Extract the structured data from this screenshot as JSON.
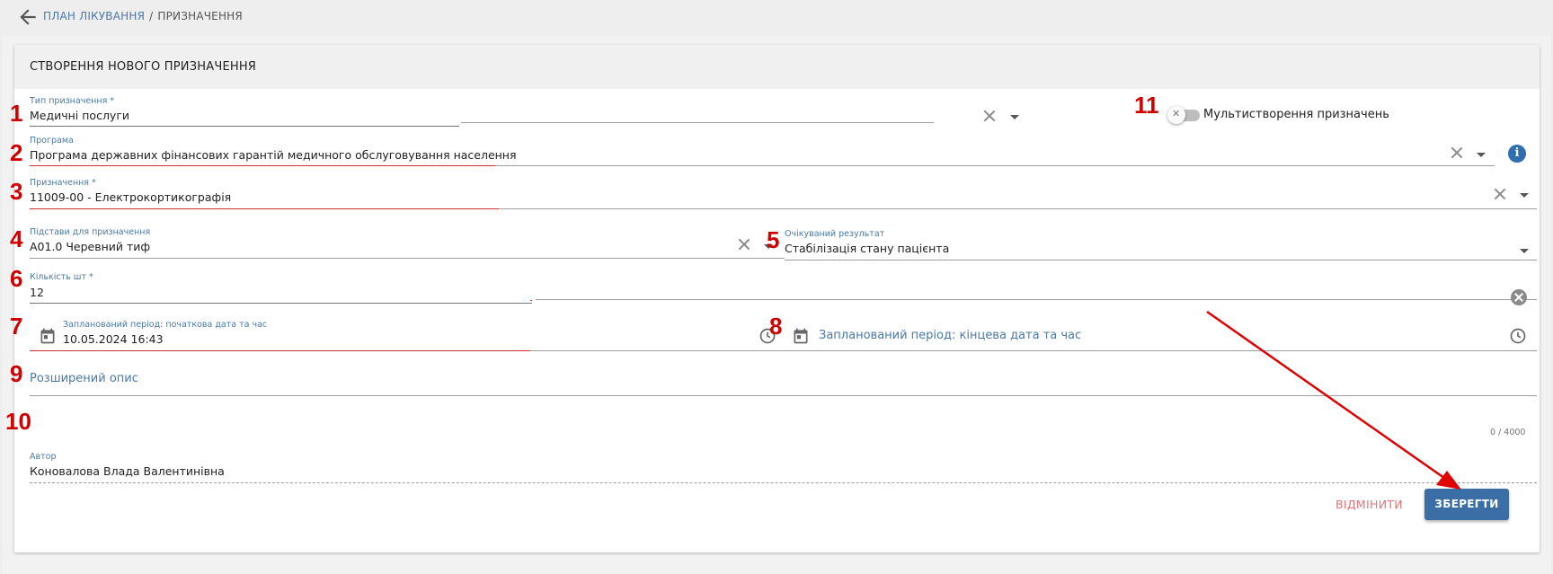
{
  "breadcrumb": {
    "back_icon": "arrow-left-icon",
    "parent": "ПЛАН ЛІКУВАННЯ",
    "separator": "/",
    "current": "ПРИЗНАЧЕННЯ"
  },
  "card": {
    "title": "СТВОРЕННЯ НОВОГО ПРИЗНАЧЕННЯ"
  },
  "form": {
    "type": {
      "label": "Тип призначення *",
      "value": "Медичні послуги"
    },
    "multi_create": {
      "label": "Мультистворення призначень",
      "checked": false
    },
    "program": {
      "label": "Програма",
      "value": "Програма державних фінансових гарантій медичного обслуговування населення"
    },
    "assignment": {
      "label": "Призначення *",
      "value": "11009-00 - Електрокортикографія"
    },
    "grounds": {
      "label": "Підстави для призначення",
      "value": "A01.0 Черевний тиф"
    },
    "expected_result": {
      "label": "Очікуваний результат",
      "value": "Стабілізація стану пацієнта"
    },
    "quantity": {
      "label": "Кількість шт *",
      "value": "12"
    },
    "start_period": {
      "label": "Запланований період: початкова дата та час",
      "value": "10.05.2024 16:43"
    },
    "end_period": {
      "placeholder": "Запланований період: кінцева дата та час"
    },
    "description": {
      "placeholder": "Розширений опис",
      "counter": "0 / 4000"
    },
    "author": {
      "label": "Автор",
      "value": "Коновалова Влада Валентинівна"
    }
  },
  "actions": {
    "cancel": "ВІДМІНИТИ",
    "save": "ЗБЕРЕГТИ"
  },
  "annotations": {
    "n1": "1",
    "n2": "2",
    "n3": "3",
    "n4": "4",
    "n5": "5",
    "n6": "6",
    "n7": "7",
    "n8": "8",
    "n9": "9",
    "n10": "10",
    "n11": "11",
    "color": "#d00000"
  },
  "colors": {
    "accent": "#3a6ea5",
    "label": "#4a79a8",
    "error": "#d32f2f",
    "cancel": "#e57373"
  }
}
